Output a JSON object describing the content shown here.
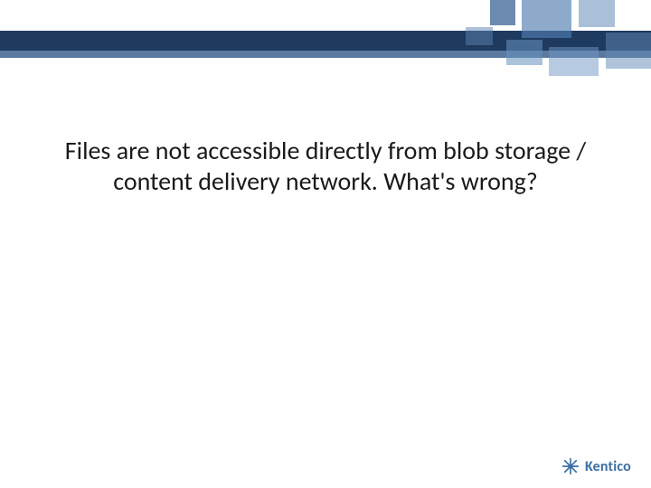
{
  "title": "Files are not accessible directly from blob storage / content delivery network. What's wrong?",
  "footer": {
    "brand": "Kentico"
  },
  "colors": {
    "band_dark": "#1f3a5f",
    "band_light": "#5a7aa0",
    "brand": "#3b6fa5"
  }
}
